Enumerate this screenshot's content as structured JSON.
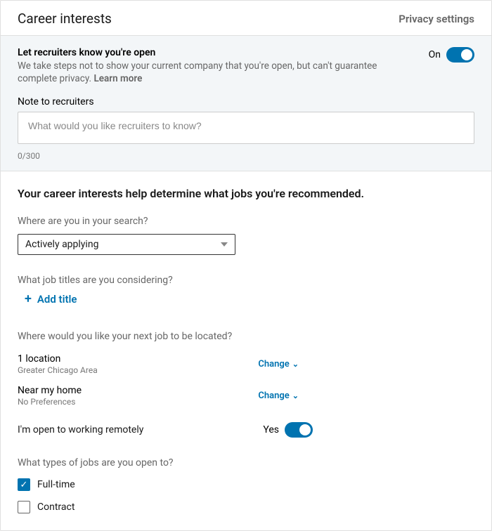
{
  "header": {
    "title": "Career interests",
    "privacy": "Privacy settings"
  },
  "recruiters": {
    "title": "Let recruiters know you're open",
    "desc_prefix": "We take steps not to show your current company that you're open, but can't guarantee complete privacy. ",
    "learn_more": "Learn more",
    "toggle_label": "On"
  },
  "note": {
    "label": "Note to recruiters",
    "placeholder": "What would you like recruiters to know?",
    "counter": "0/300"
  },
  "main": {
    "heading": "Your career interests help determine what jobs you're recommended.",
    "search_q": "Where are you in your search?",
    "search_value": "Actively applying",
    "titles_q": "What job titles are you considering?",
    "add_title": "Add title",
    "location_q": "Where would you like your next job to be located?",
    "loc1_title": "1 location",
    "loc1_sub": "Greater Chicago Area",
    "loc2_title": "Near my home",
    "loc2_sub": "No Preferences",
    "change": "Change",
    "remote_label": "I'm open to working remotely",
    "remote_value": "Yes",
    "types_q": "What types of jobs are you open to?",
    "type1": "Full-time",
    "type2": "Contract"
  }
}
